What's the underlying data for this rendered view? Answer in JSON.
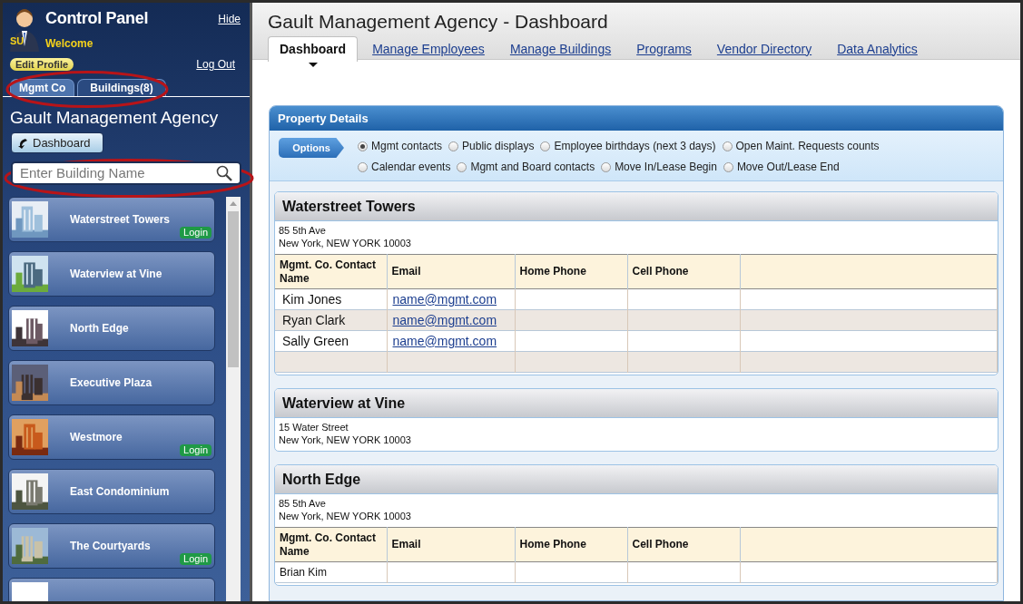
{
  "sidebar": {
    "title": "Control Panel",
    "hide_link": "Hide",
    "avatar_label": "SU",
    "welcome": "Welcome",
    "edit_profile": "Edit Profile",
    "logout": "Log Out",
    "tabs": [
      {
        "label": "Mgmt Co",
        "selected": true
      },
      {
        "label": "Buildings(8)",
        "selected": false
      }
    ],
    "agency_name": "Gault Management Agency",
    "dashboard_button": "Dashboard",
    "search": {
      "placeholder": "Enter Building Name"
    },
    "buildings": [
      {
        "name": "Waterstreet Towers",
        "login": "Login"
      },
      {
        "name": "Waterview at Vine"
      },
      {
        "name": "North Edge"
      },
      {
        "name": "Executive Plaza"
      },
      {
        "name": "Westmore",
        "login": "Login"
      },
      {
        "name": "East Condominium"
      },
      {
        "name": "The Courtyards",
        "login": "Login"
      }
    ]
  },
  "main": {
    "title": "Gault Management Agency - Dashboard",
    "tabs": [
      {
        "label": "Dashboard",
        "selected": true
      },
      {
        "label": "Manage Employees",
        "selected": false
      },
      {
        "label": "Manage Buildings",
        "selected": false
      },
      {
        "label": "Programs",
        "selected": false
      },
      {
        "label": "Vendor Directory",
        "selected": false
      },
      {
        "label": "Data Analytics",
        "selected": false
      }
    ],
    "panel": {
      "title": "Property Details",
      "options_label": "Options",
      "options": [
        {
          "label": "Mgmt contacts",
          "selected": true
        },
        {
          "label": "Public displays",
          "selected": false
        },
        {
          "label": "Employee birthdays (next 3 days)",
          "selected": false
        },
        {
          "label": "Open Maint. Requests counts",
          "selected": false
        },
        {
          "label": "Calendar events",
          "selected": false
        },
        {
          "label": "Mgmt and Board contacts",
          "selected": false
        },
        {
          "label": "Move In/Lease Begin",
          "selected": false
        },
        {
          "label": "Move Out/Lease End",
          "selected": false
        }
      ],
      "properties": [
        {
          "name": "Waterstreet Towers",
          "address_lines": [
            "85 5th Ave",
            "New York, NEW YORK 10003"
          ],
          "table": {
            "columns": [
              "Mgmt. Co. Contact Name",
              "Email",
              "Home Phone",
              "Cell Phone"
            ],
            "trailing_blank": true,
            "rows": [
              {
                "name": "Kim Jones",
                "email": "name@mgmt.com"
              },
              {
                "name": "Ryan Clark",
                "email": "name@mgmt.com"
              },
              {
                "name": "Sally Green",
                "email": "name@mgmt.com"
              }
            ]
          }
        },
        {
          "name": "Waterview at Vine",
          "address_lines": [
            "15 Water Street",
            "New York, NEW YORK 10003"
          ]
        },
        {
          "name": "North Edge",
          "address_lines": [
            "85 5th Ave",
            "New York, NEW YORK 10003"
          ],
          "table": {
            "columns": [
              "Mgmt. Co. Contact Name",
              "Email",
              "Home Phone",
              "Cell Phone"
            ],
            "trailing_blank": false,
            "rows": [
              {
                "name": "Brian Kim"
              }
            ]
          }
        }
      ]
    }
  }
}
